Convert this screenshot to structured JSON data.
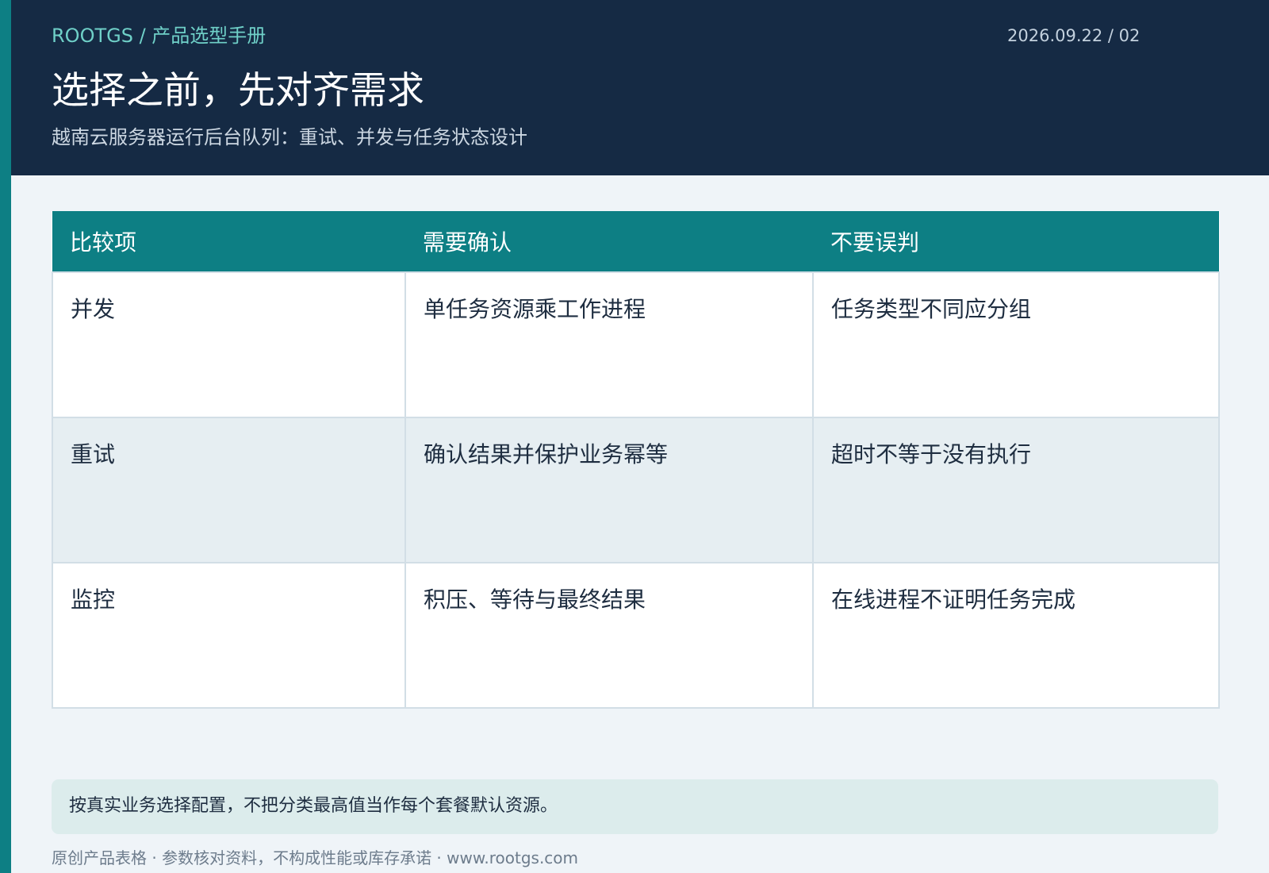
{
  "header": {
    "breadcrumb": "ROOTGS / 产品选型手册",
    "meta": "2026.09.22 / 02",
    "title": "选择之前，先对齐需求",
    "subtitle": "越南云服务器运行后台队列：重试、并发与任务状态设计"
  },
  "table": {
    "headers": [
      "比较项",
      "需要确认",
      "不要误判"
    ],
    "rows": [
      [
        "并发",
        "单任务资源乘工作进程",
        "任务类型不同应分组"
      ],
      [
        "重试",
        "确认结果并保护业务幂等",
        "超时不等于没有执行"
      ],
      [
        "监控",
        "积压、等待与最终结果",
        "在线进程不证明任务完成"
      ]
    ]
  },
  "note": {
    "text": "按真实业务选择配置，不把分类最高值当作每个套餐默认资源。"
  },
  "footer": {
    "text": "原创产品表格 · 参数核对资料，不构成性能或库存承诺 · www.rootgs.com"
  },
  "colors": {
    "accent": "#0d7f84",
    "header_bg": "#152a44",
    "breadcrumb": "#6fd0c8",
    "page_bg": "#eff4f8",
    "alt_row": "#e6eef2",
    "note_bg": "#dcecec"
  }
}
